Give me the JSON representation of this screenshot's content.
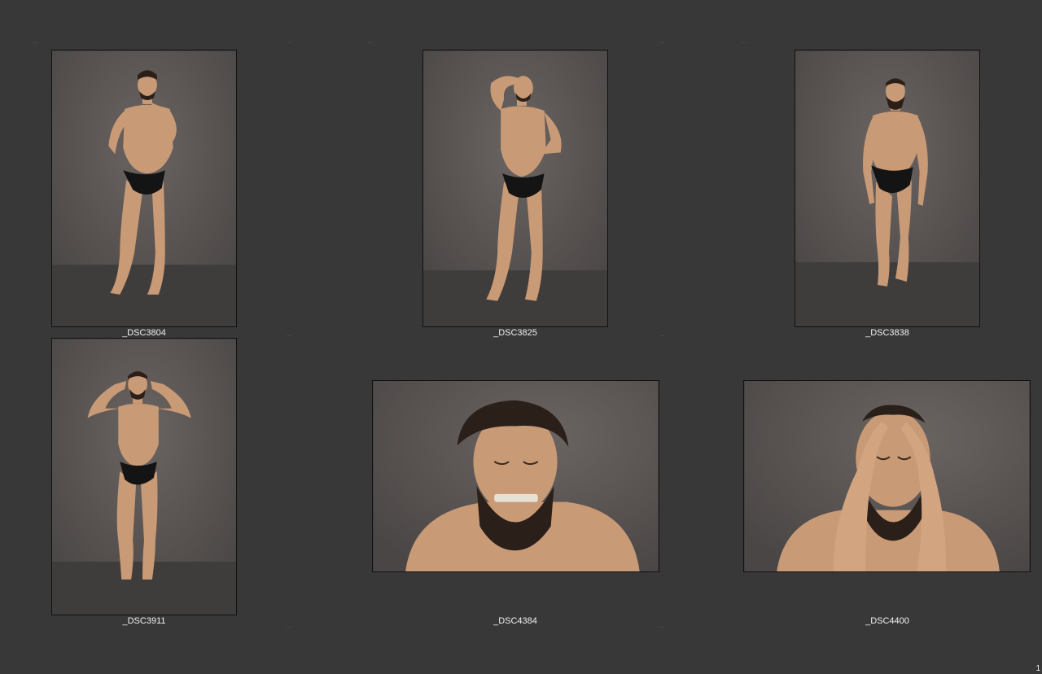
{
  "contact_sheet": {
    "photos": [
      {
        "filename": "_DSC3804",
        "orientation": "portrait",
        "pose": "standing-hand-on-chin"
      },
      {
        "filename": "_DSC3825",
        "orientation": "portrait",
        "pose": "standing-arm-over-head"
      },
      {
        "filename": "_DSC3838",
        "orientation": "portrait",
        "pose": "hunched-walking"
      },
      {
        "filename": "_DSC3911",
        "orientation": "portrait",
        "pose": "standing-fingers-in-ears"
      },
      {
        "filename": "_DSC4384",
        "orientation": "landscape",
        "pose": "closeup-fingers-pulling-mouth"
      },
      {
        "filename": "_DSC4400",
        "orientation": "landscape",
        "pose": "closeup-hands-on-face"
      }
    ],
    "page_number": "1"
  },
  "colors": {
    "background": "#383838",
    "backdrop": "#5b5654",
    "floor": "#3f3d3c",
    "skin": "#c99a76",
    "hair": "#2a1f19",
    "briefs": "#141414",
    "caption_text": "#f2f2f2"
  }
}
